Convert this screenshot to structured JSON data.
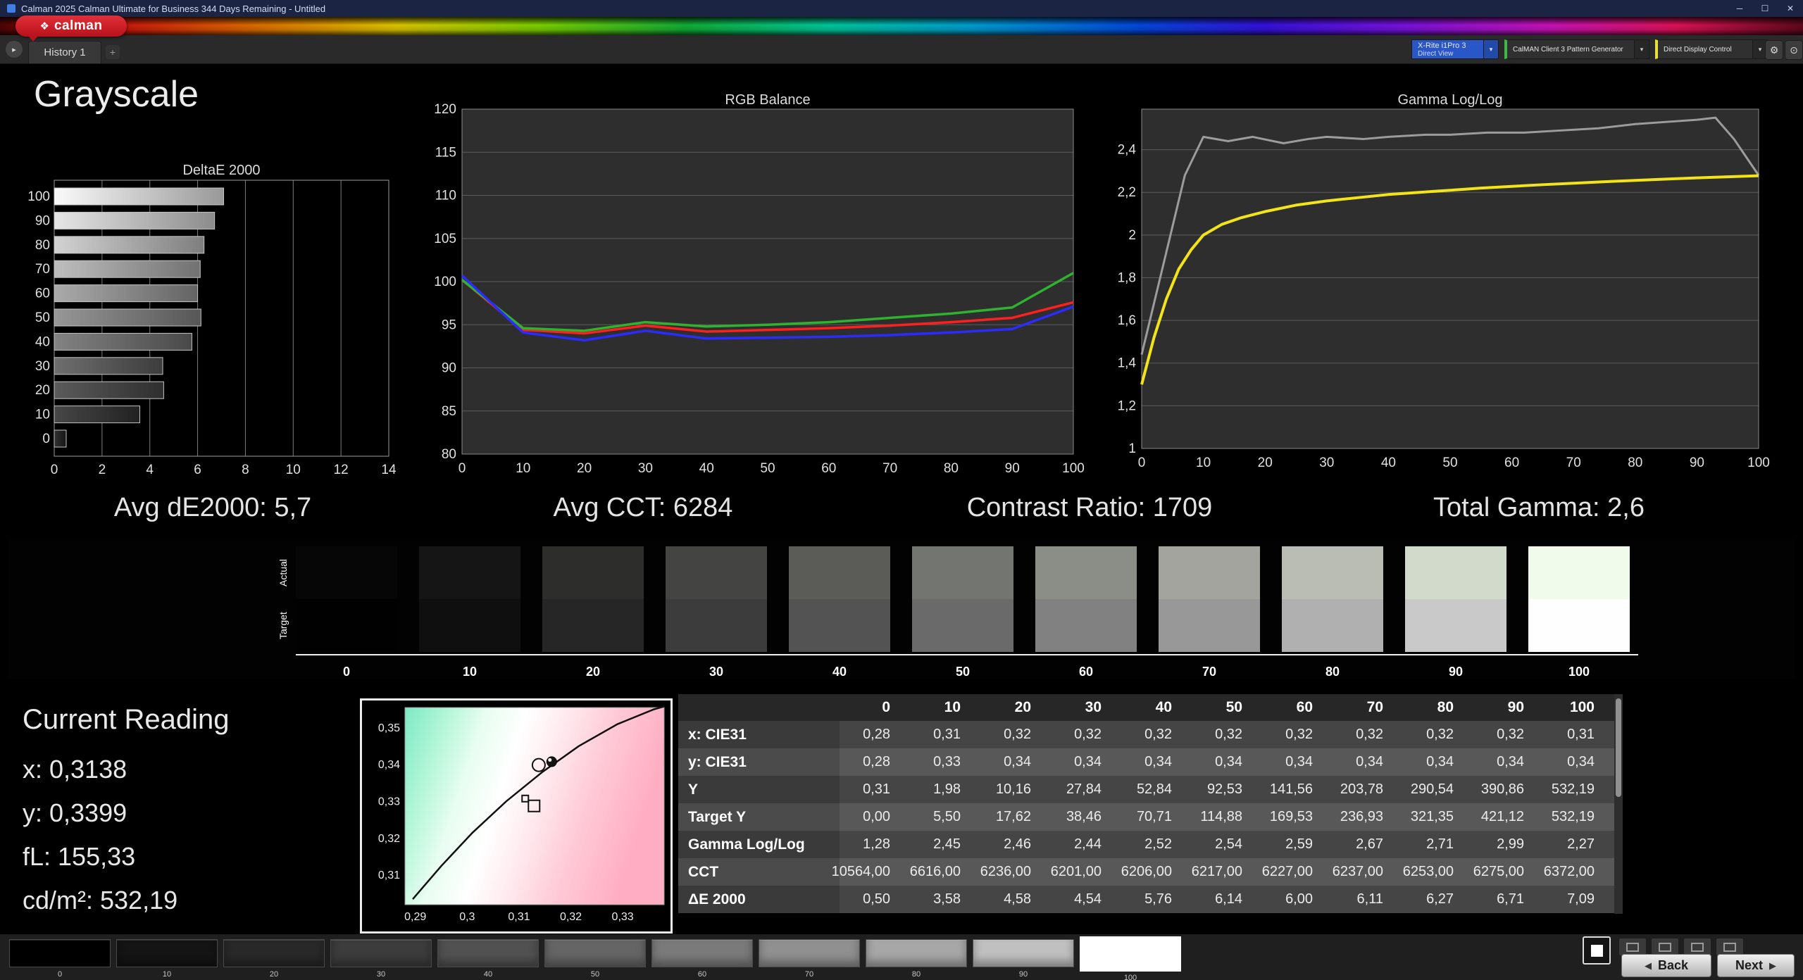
{
  "window": {
    "title": "Calman 2025 Calman Ultimate for Business 344 Days Remaining  - Untitled"
  },
  "icons": {
    "minimize": "─",
    "maximize": "☐",
    "close": "✕",
    "logo_mark": "❖",
    "play": "▸",
    "plus": "+",
    "chevron": "▾",
    "gear": "⚙",
    "target": "⊙",
    "back_arrow": "◀",
    "next_arrow": "▶"
  },
  "brand": {
    "logo": "calman"
  },
  "nav": {
    "history_tab": "History 1"
  },
  "toolbar": {
    "meter_line1": "X-Rite i1Pro 3",
    "meter_line2": "Direct View",
    "source_label": "CalMAN Client 3 Pattern Generator",
    "display_label": "Direct Display Control"
  },
  "page_title": "Grayscale",
  "stats": {
    "avg_de": "Avg dE2000: 5,7",
    "avg_cct": "Avg CCT: 6284",
    "contrast": "Contrast Ratio: 1709",
    "total_gamma": "Total Gamma: 2,6"
  },
  "chart_data": [
    {
      "type": "bar",
      "orientation": "horizontal",
      "title": "DeltaE 2000",
      "categories": [
        "100",
        "90",
        "80",
        "70",
        "60",
        "50",
        "40",
        "30",
        "20",
        "10",
        "0"
      ],
      "values": [
        7.09,
        6.71,
        6.27,
        6.11,
        6.0,
        6.14,
        5.76,
        4.54,
        4.58,
        3.58,
        0.5
      ],
      "xlim": [
        0,
        14
      ],
      "xticks": [
        0,
        2,
        4,
        6,
        8,
        10,
        12,
        14
      ]
    },
    {
      "type": "line",
      "title": "RGB Balance",
      "x": [
        0,
        10,
        20,
        30,
        40,
        50,
        60,
        70,
        80,
        90,
        100
      ],
      "ylim": [
        80,
        120
      ],
      "yticks": [
        120,
        115,
        110,
        105,
        100,
        95,
        90,
        85,
        80
      ],
      "series": [
        {
          "name": "red",
          "color": "#ff1f1f",
          "values": [
            100.2,
            94.4,
            94.0,
            94.9,
            94.2,
            94.4,
            94.6,
            94.9,
            95.3,
            95.8,
            97.6
          ]
        },
        {
          "name": "green",
          "color": "#2fb32f",
          "values": [
            100.2,
            94.6,
            94.3,
            95.3,
            94.8,
            95.0,
            95.3,
            95.8,
            96.3,
            97.0,
            101.0
          ]
        },
        {
          "name": "blue",
          "color": "#2b2bff",
          "values": [
            100.7,
            94.1,
            93.2,
            94.3,
            93.4,
            93.5,
            93.6,
            93.8,
            94.1,
            94.5,
            97.1
          ]
        }
      ]
    },
    {
      "type": "line",
      "title": "Gamma Log/Log",
      "xticks": [
        0,
        10,
        20,
        30,
        40,
        50,
        60,
        70,
        80,
        90,
        100
      ],
      "ylim": [
        1,
        2.59
      ],
      "yticks": [
        2.4,
        2.2,
        2,
        1.8,
        1.6,
        1.4,
        1.2,
        1
      ],
      "yticks_labels": [
        "2,4",
        "2,2",
        "2",
        "1,8",
        "1,6",
        "1,4",
        "1,2",
        "1"
      ],
      "series": [
        {
          "name": "target-gamma",
          "color": "#9c9c9c",
          "width": 3,
          "points": [
            [
              0,
              1.44
            ],
            [
              4,
              1.92
            ],
            [
              7,
              2.28
            ],
            [
              10,
              2.46
            ],
            [
              14,
              2.44
            ],
            [
              18,
              2.46
            ],
            [
              23,
              2.43
            ],
            [
              27,
              2.45
            ],
            [
              30,
              2.46
            ],
            [
              36,
              2.45
            ],
            [
              40,
              2.46
            ],
            [
              46,
              2.47
            ],
            [
              50,
              2.47
            ],
            [
              56,
              2.48
            ],
            [
              62,
              2.48
            ],
            [
              68,
              2.49
            ],
            [
              74,
              2.5
            ],
            [
              80,
              2.52
            ],
            [
              85,
              2.53
            ],
            [
              90,
              2.54
            ],
            [
              93,
              2.55
            ],
            [
              96,
              2.45
            ],
            [
              100,
              2.28
            ]
          ]
        },
        {
          "name": "measured-gamma",
          "color": "#f2e419",
          "width": 4,
          "points": [
            [
              0,
              1.3
            ],
            [
              2,
              1.52
            ],
            [
              4,
              1.7
            ],
            [
              6,
              1.84
            ],
            [
              8,
              1.93
            ],
            [
              10,
              2.0
            ],
            [
              13,
              2.05
            ],
            [
              16,
              2.08
            ],
            [
              20,
              2.11
            ],
            [
              25,
              2.14
            ],
            [
              30,
              2.16
            ],
            [
              35,
              2.175
            ],
            [
              40,
              2.19
            ],
            [
              45,
              2.2
            ],
            [
              50,
              2.21
            ],
            [
              55,
              2.22
            ],
            [
              60,
              2.228
            ],
            [
              65,
              2.236
            ],
            [
              70,
              2.243
            ],
            [
              75,
              2.25
            ],
            [
              80,
              2.256
            ],
            [
              85,
              2.262
            ],
            [
              90,
              2.268
            ],
            [
              95,
              2.273
            ],
            [
              100,
              2.278
            ]
          ]
        }
      ]
    },
    {
      "type": "scatter",
      "title": "CIE chromaticity",
      "xlim": [
        0.288,
        0.338
      ],
      "ylim": [
        0.302,
        0.3555
      ],
      "xticks": [
        0.29,
        0.3,
        0.31,
        0.32,
        0.33
      ],
      "xticks_labels": [
        "0,29",
        "0,3",
        "0,31",
        "0,32",
        "0,33"
      ],
      "yticks": [
        0.35,
        0.34,
        0.33,
        0.32,
        0.31
      ],
      "yticks_labels": [
        "0,35",
        "0,34",
        "0,33",
        "0,32",
        "0,31"
      ],
      "locus": [
        [
          0.2895,
          0.3035
        ],
        [
          0.295,
          0.3125
        ],
        [
          0.301,
          0.3215
        ],
        [
          0.3075,
          0.33
        ],
        [
          0.3145,
          0.338
        ],
        [
          0.3215,
          0.345
        ],
        [
          0.329,
          0.351
        ],
        [
          0.336,
          0.355
        ],
        [
          0.338,
          0.3558
        ]
      ],
      "markers": [
        {
          "shape": "circle-open",
          "x": 0.3138,
          "y": 0.3399
        },
        {
          "shape": "circle-dot",
          "x": 0.3163,
          "y": 0.3408
        },
        {
          "shape": "square-small",
          "x": 0.3112,
          "y": 0.3308
        },
        {
          "shape": "square-open",
          "x": 0.3129,
          "y": 0.3288
        }
      ]
    }
  ],
  "swatch_strip": {
    "actual_label": "Actual",
    "target_label": "Target",
    "levels": [
      "0",
      "10",
      "20",
      "30",
      "40",
      "50",
      "60",
      "70",
      "80",
      "90",
      "100"
    ],
    "actual_colors": [
      "#060606",
      "#151515",
      "#2d2d2b",
      "#444442",
      "#5b5b58",
      "#737570",
      "#8b8d87",
      "#a2a49d",
      "#babdb3",
      "#d2dacb",
      "#f0fbeb"
    ],
    "target_colors": [
      "#010101",
      "#0f0f0f",
      "#262626",
      "#3c3c3c",
      "#535353",
      "#6a6a6a",
      "#818181",
      "#989898",
      "#b0b0b0",
      "#c9c9c9",
      "#fefefe"
    ]
  },
  "current_reading": {
    "title": "Current Reading",
    "x": "x: 0,3138",
    "y": "y: 0,3399",
    "fl": "fL: 155,33",
    "cd": "cd/m²: 532,19"
  },
  "table": {
    "columns": [
      "0",
      "10",
      "20",
      "30",
      "40",
      "50",
      "60",
      "70",
      "80",
      "90",
      "100"
    ],
    "rows": [
      {
        "label": "x: CIE31",
        "values": [
          "0,28",
          "0,31",
          "0,32",
          "0,32",
          "0,32",
          "0,32",
          "0,32",
          "0,32",
          "0,32",
          "0,32",
          "0,31"
        ]
      },
      {
        "label": "y: CIE31",
        "values": [
          "0,28",
          "0,33",
          "0,34",
          "0,34",
          "0,34",
          "0,34",
          "0,34",
          "0,34",
          "0,34",
          "0,34",
          "0,34"
        ]
      },
      {
        "label": "Y",
        "values": [
          "0,31",
          "1,98",
          "10,16",
          "27,84",
          "52,84",
          "92,53",
          "141,56",
          "203,78",
          "290,54",
          "390,86",
          "532,19"
        ]
      },
      {
        "label": "Target Y",
        "values": [
          "0,00",
          "5,50",
          "17,62",
          "38,46",
          "70,71",
          "114,88",
          "169,53",
          "236,93",
          "321,35",
          "421,12",
          "532,19"
        ]
      },
      {
        "label": "Gamma Log/Log",
        "values": [
          "1,28",
          "2,45",
          "2,46",
          "2,44",
          "2,52",
          "2,54",
          "2,59",
          "2,67",
          "2,71",
          "2,99",
          "2,27"
        ]
      },
      {
        "label": "CCT",
        "values": [
          "10564,00",
          "6616,00",
          "6236,00",
          "6201,00",
          "6206,00",
          "6217,00",
          "6227,00",
          "6237,00",
          "6253,00",
          "6275,00",
          "6372,00"
        ]
      },
      {
        "label": "ΔE 2000",
        "values": [
          "0,50",
          "3,58",
          "4,58",
          "4,54",
          "5,76",
          "6,14",
          "6,00",
          "6,11",
          "6,27",
          "6,71",
          "7,09"
        ]
      }
    ]
  },
  "pattern_bar": {
    "levels": [
      "0",
      "10",
      "20",
      "30",
      "40",
      "50",
      "60",
      "70",
      "80",
      "90",
      "100"
    ],
    "colors": [
      "#000000",
      "#141414",
      "#282828",
      "#3c3c3c",
      "#515151",
      "#656565",
      "#7a7a7a",
      "#909090",
      "#a7a7a7",
      "#c0c0c0",
      "#ffffff"
    ],
    "selected_index": 10,
    "back": "Back",
    "next": "Next"
  }
}
